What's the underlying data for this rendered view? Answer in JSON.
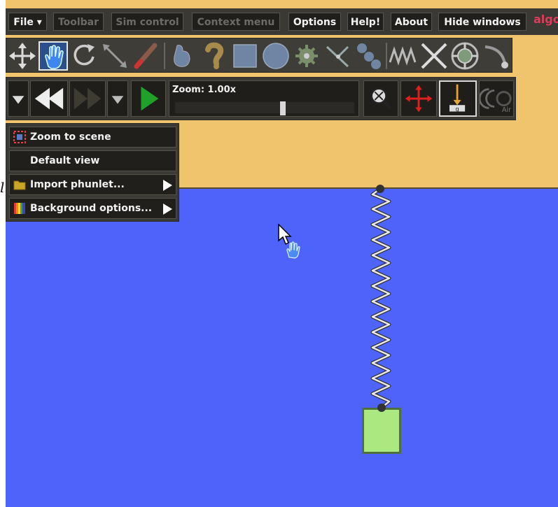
{
  "menubar": {
    "file": "File ▾",
    "toolbar": "Toolbar",
    "sim_control": "Sim control",
    "context_menu": "Context menu",
    "options": "Options",
    "help": "Help!",
    "about": "About",
    "hide_windows": "Hide windows",
    "logo": "algo"
  },
  "tools": {
    "items": [
      "move-tool",
      "drag-tool",
      "rotate-tool",
      "scale-tool",
      "brush-tool",
      "polygon-tool",
      "chain-tool",
      "box-tool",
      "circle-tool",
      "gear-tool",
      "fixate-tool",
      "hinge-tool",
      "spring-tool",
      "remove-tool",
      "thruster-tool",
      "tracer-tool"
    ],
    "selected": "drag-tool"
  },
  "simcontrol": {
    "zoom_label": "Zoom: 1.00x",
    "zoom_value": 1.0,
    "air_label": "Air"
  },
  "context_menu": {
    "items": [
      {
        "label": "Zoom to scene",
        "icon": "zoom-to-scene-icon",
        "submenu": false
      },
      {
        "label": "Default view",
        "icon": "",
        "submenu": false
      },
      {
        "label": "Import phunlet...",
        "icon": "folder-icon",
        "submenu": true
      },
      {
        "label": "Background options...",
        "icon": "rainbow-icon",
        "submenu": true
      }
    ]
  },
  "artifact_text": "l",
  "colors": {
    "sky": "#efc46c",
    "ground": "#4d63fa",
    "block_fill": "#abe880",
    "block_border": "#4f6f3b",
    "play_green": "#1fa12a",
    "move_red": "#e02020"
  }
}
